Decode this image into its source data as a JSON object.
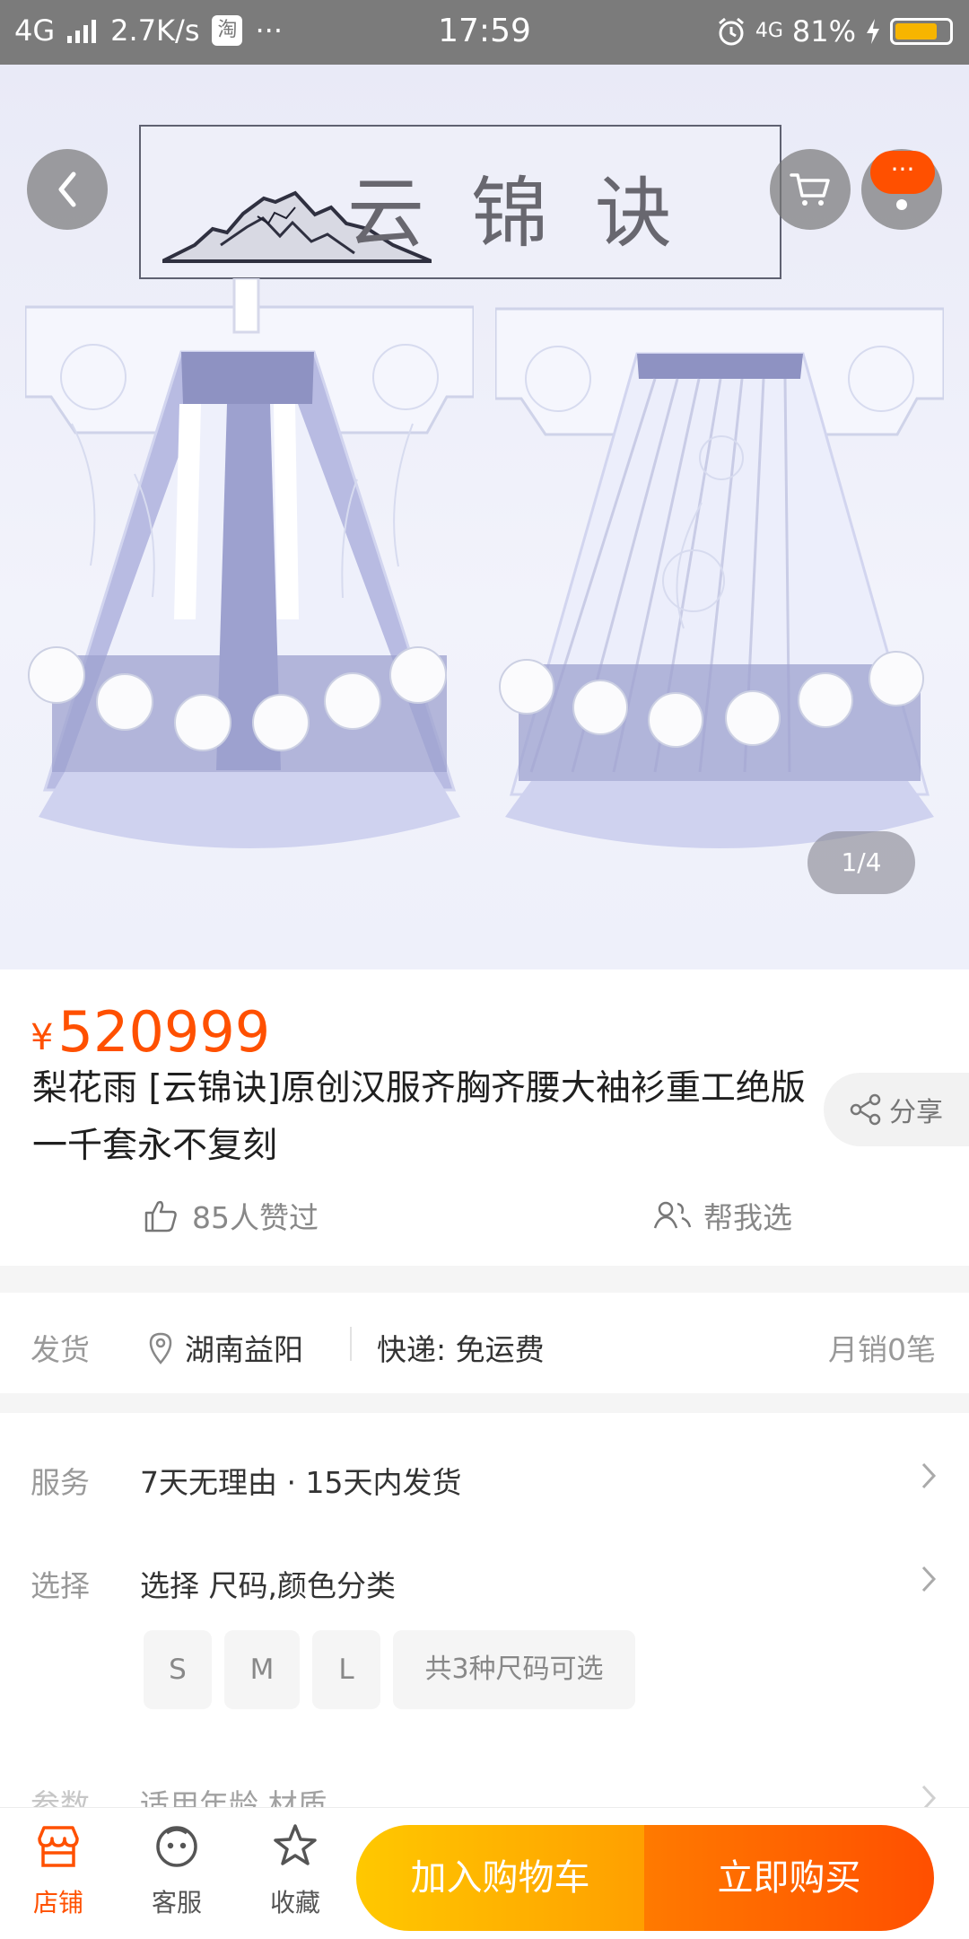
{
  "status_bar": {
    "network": "4G",
    "speed": "2.7K/s",
    "taobao_mark": "淘",
    "dots": "···",
    "time": "17:59",
    "network_right": "4G",
    "battery_text": "81%",
    "battery_level": 0.81,
    "battery_color": "#f7b500"
  },
  "hero": {
    "brand_title": "云锦诀",
    "page_indicator": "1/4",
    "back_icon": "chevron-left-icon",
    "cart_icon": "cart-icon",
    "more_icon": "more-icon",
    "more_badge": "···"
  },
  "product": {
    "currency": "¥",
    "price": "520999",
    "price_color": "#ff5000",
    "title": "梨花雨 [云锦诀]原创汉服齐胸齐腰大袖衫重工绝版一千套永不复刻",
    "share_label": "分享",
    "likes_label": "85人赞过",
    "help_label": "帮我选"
  },
  "delivery": {
    "label": "发货",
    "location": "湖南益阳",
    "shipping": "快递: 免运费",
    "monthly_sales": "月销0笔"
  },
  "service": {
    "label": "服务",
    "text": "7天无理由 · 15天内发货"
  },
  "selection": {
    "label": "选择",
    "text": "选择 尺码,颜色分类",
    "sizes": [
      "S",
      "M",
      "L"
    ],
    "summary": "共3种尺码可选"
  },
  "params": {
    "label": "参数",
    "text": "适用年龄 材质"
  },
  "bottom_bar": {
    "shop": "店铺",
    "customer_service": "客服",
    "favorite": "收藏",
    "add_to_cart": "加入购物车",
    "buy_now": "立即购买"
  }
}
